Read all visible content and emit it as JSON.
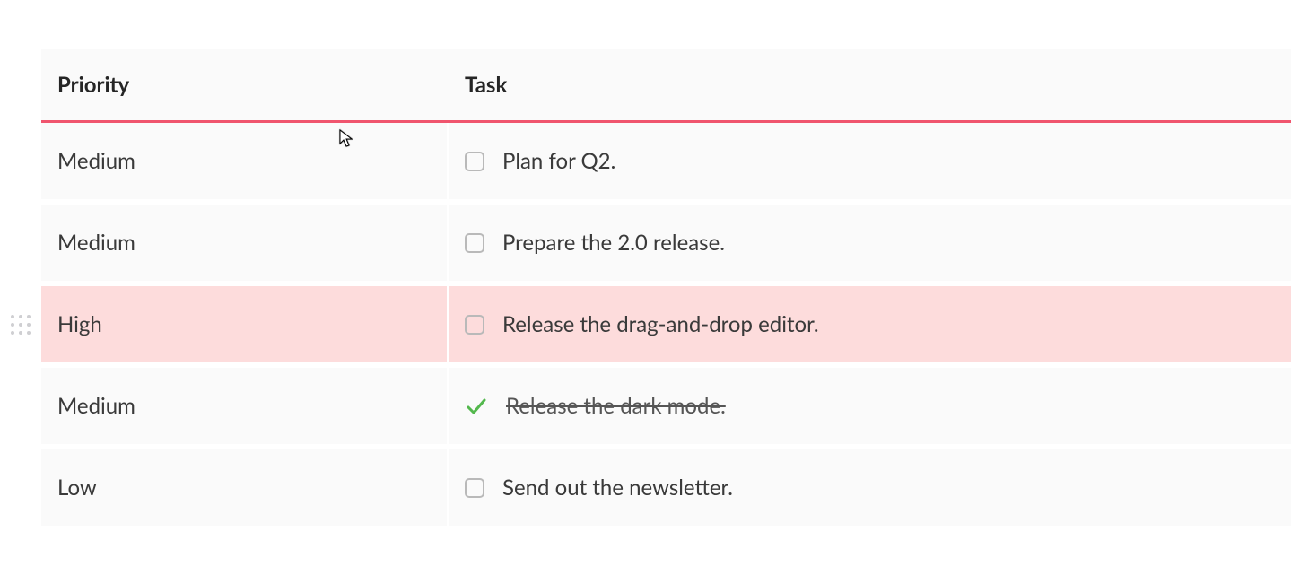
{
  "table": {
    "headers": {
      "priority": "Priority",
      "task": "Task"
    },
    "rows": [
      {
        "priority": "Medium",
        "task": "Plan for Q2.",
        "done": false,
        "highlight": false
      },
      {
        "priority": "Medium",
        "task": "Prepare the 2.0 release.",
        "done": false,
        "highlight": false
      },
      {
        "priority": "High",
        "task": "Release the drag-and-drop editor.",
        "done": false,
        "highlight": true
      },
      {
        "priority": "Medium",
        "task": "Release the dark mode.",
        "done": true,
        "highlight": false
      },
      {
        "priority": "Low",
        "task": "Send out the newsletter.",
        "done": false,
        "highlight": false
      }
    ]
  },
  "colors": {
    "accent": "#f0556e",
    "highlight": "#fddcdc",
    "check": "#53b84d"
  }
}
